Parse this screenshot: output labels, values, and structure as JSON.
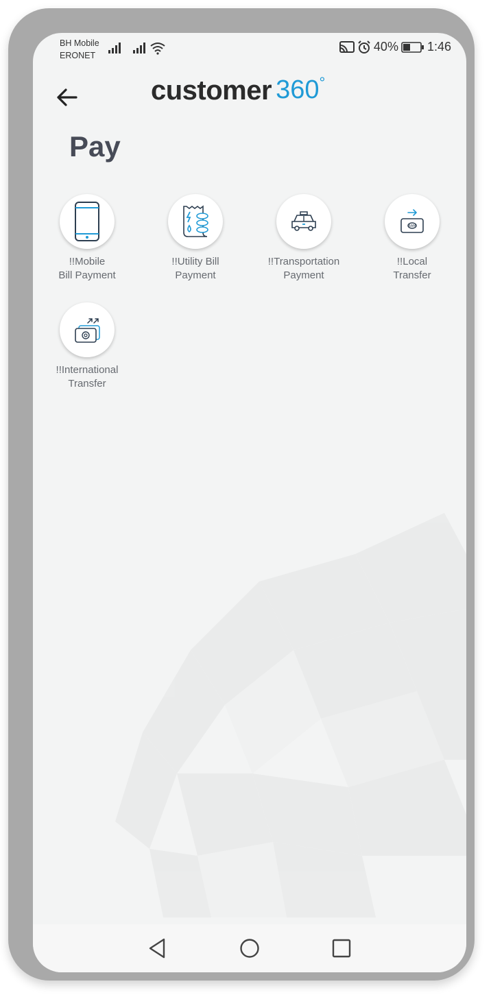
{
  "status_bar": {
    "carrier_1": "BH Mobile",
    "carrier_2": "ERONET",
    "battery": "40%",
    "time": "1:46"
  },
  "header": {
    "logo_main": "customer",
    "logo_accent": "360",
    "logo_degree": "°"
  },
  "page": {
    "title": "Pay"
  },
  "tiles": [
    {
      "line1": "!!Mobile",
      "line2": "Bill Payment",
      "icon": "phone-icon"
    },
    {
      "line1": "!!Utility Bill",
      "line2": "Payment",
      "icon": "utility-bill-icon"
    },
    {
      "line1": "!!Transportation",
      "line2": "Payment",
      "icon": "car-icon"
    },
    {
      "line1": "!!Local",
      "line2": "Transfer",
      "icon": "local-transfer-icon"
    },
    {
      "line1": "!!International",
      "line2": "Transfer",
      "icon": "international-transfer-icon"
    }
  ],
  "colors": {
    "accent": "#1f9ad6",
    "title": "#474b57",
    "label": "#666a70"
  }
}
